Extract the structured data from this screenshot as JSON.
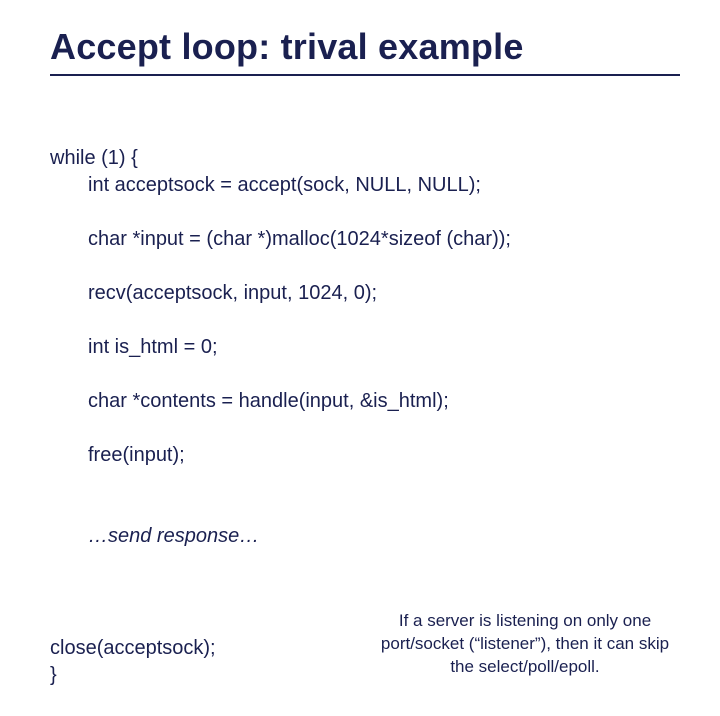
{
  "title": "Accept loop: trival example",
  "code": {
    "l0": "while (1) {",
    "l1": "int acceptsock = accept(sock, NULL, NULL);",
    "l2": "char *input = (char *)malloc(1024*sizeof (char));",
    "l3": "recv(acceptsock, input, 1024, 0);",
    "l4": "int is_html = 0;",
    "l5": "char *contents = handle(input, &is_html);",
    "l6": "free(input);",
    "comment": "…send response…",
    "l7": "close(acceptsock);",
    "l8": "}"
  },
  "note": "If a server is listening on only one port/socket (“listener”), then it can skip the select/poll/epoll."
}
